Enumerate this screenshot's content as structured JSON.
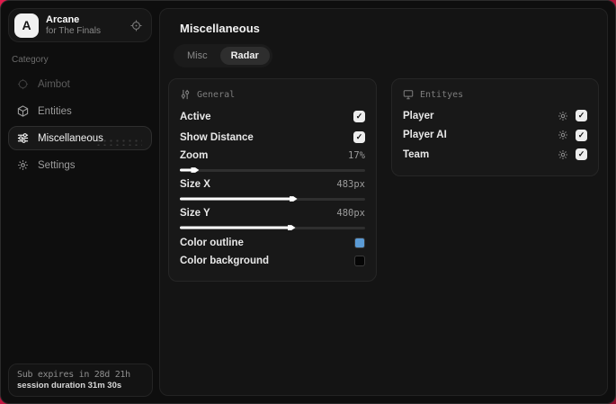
{
  "glyphs": {
    "check": "✓"
  },
  "colors": {
    "outline_swatch": "#5b9bd5",
    "background_swatch": "#050505"
  },
  "sidebar": {
    "brand": {
      "logo_letter": "A",
      "title": "Arcane",
      "subtitle": "for The Finals"
    },
    "category_label": "Category",
    "items": [
      {
        "label": "Aimbot",
        "active": false
      },
      {
        "label": "Entities",
        "active": false
      },
      {
        "label": "Miscellaneous",
        "active": true
      },
      {
        "label": "Settings",
        "active": false
      }
    ],
    "footer": {
      "line1": "Sub expires in 28d 21h",
      "line2": "session duration 31m 30s"
    }
  },
  "main": {
    "title": "Miscellaneous",
    "tabs": [
      {
        "label": "Misc",
        "active": false
      },
      {
        "label": "Radar",
        "active": true
      }
    ],
    "panels": {
      "general": {
        "title": "General",
        "rows": [
          {
            "label": "Active",
            "type": "checkbox",
            "checked": true
          },
          {
            "label": "Show Distance",
            "type": "checkbox",
            "checked": true
          },
          {
            "label": "Zoom",
            "type": "slider",
            "value": "17%",
            "percent": 7
          },
          {
            "label": "Size X",
            "type": "slider",
            "value": "483px",
            "percent": 60
          },
          {
            "label": "Size Y",
            "type": "slider",
            "value": "480px",
            "percent": 59
          },
          {
            "label": "Color outline",
            "type": "color",
            "color": "#5b9bd5"
          },
          {
            "label": "Color background",
            "type": "color",
            "color": "#050505"
          }
        ]
      },
      "entities": {
        "title": "Entityes",
        "rows": [
          {
            "label": "Player",
            "checked": true
          },
          {
            "label": "Player AI",
            "checked": true
          },
          {
            "label": "Team",
            "checked": true
          }
        ]
      }
    }
  }
}
